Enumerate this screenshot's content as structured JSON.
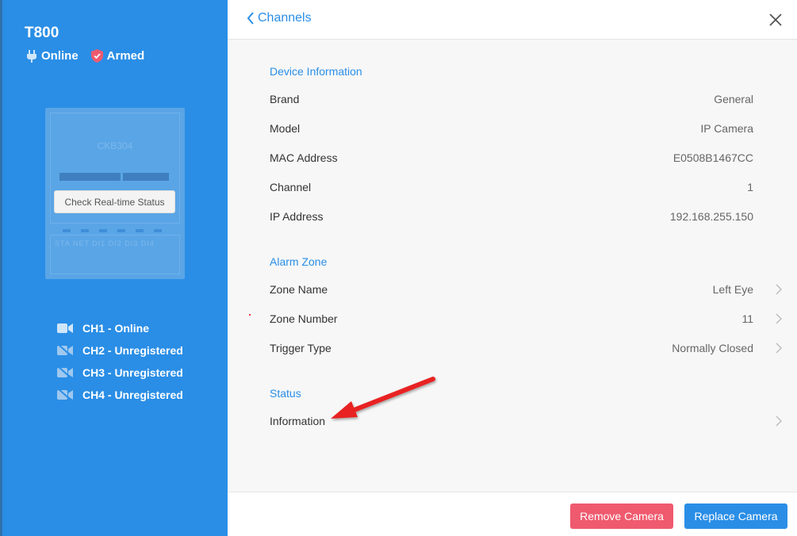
{
  "device": {
    "name": "T800",
    "online_label": "Online",
    "armed_label": "Armed",
    "model_text": "CKB304",
    "realtime_button": "Check Real-time Status",
    "port_labels": "STA NET DI1 DI2 DI3 DI4"
  },
  "channels": [
    {
      "label": "CH1 - Online",
      "icon": "camera-icon"
    },
    {
      "label": "CH2 - Unregistered",
      "icon": "camera-off-icon"
    },
    {
      "label": "CH3 - Unregistered",
      "icon": "camera-off-icon"
    },
    {
      "label": "CH4 - Unregistered",
      "icon": "camera-off-icon"
    }
  ],
  "header": {
    "back_label": "Channels"
  },
  "device_info": {
    "title": "Device Information",
    "rows": [
      {
        "label": "Brand",
        "value": "General"
      },
      {
        "label": "Model",
        "value": "IP Camera"
      },
      {
        "label": "MAC Address",
        "value": "E0508B1467CC"
      },
      {
        "label": "Channel",
        "value": "1"
      },
      {
        "label": "IP Address",
        "value": "192.168.255.150"
      }
    ]
  },
  "alarm_zone": {
    "title": "Alarm Zone",
    "rows": [
      {
        "label": "Zone Name",
        "value": "Left Eye"
      },
      {
        "label": "Zone Number",
        "value": "11"
      },
      {
        "label": "Trigger Type",
        "value": "Normally Closed"
      }
    ]
  },
  "status": {
    "title": "Status",
    "rows": [
      {
        "label": "Information",
        "value": ""
      }
    ]
  },
  "footer": {
    "remove_label": "Remove Camera",
    "replace_label": "Replace Camera"
  },
  "colors": {
    "primary": "#2a8ee6",
    "danger": "#ef5a6f",
    "armed_icon": "#ef5a6f",
    "annotation_arrow": "#e82323"
  }
}
